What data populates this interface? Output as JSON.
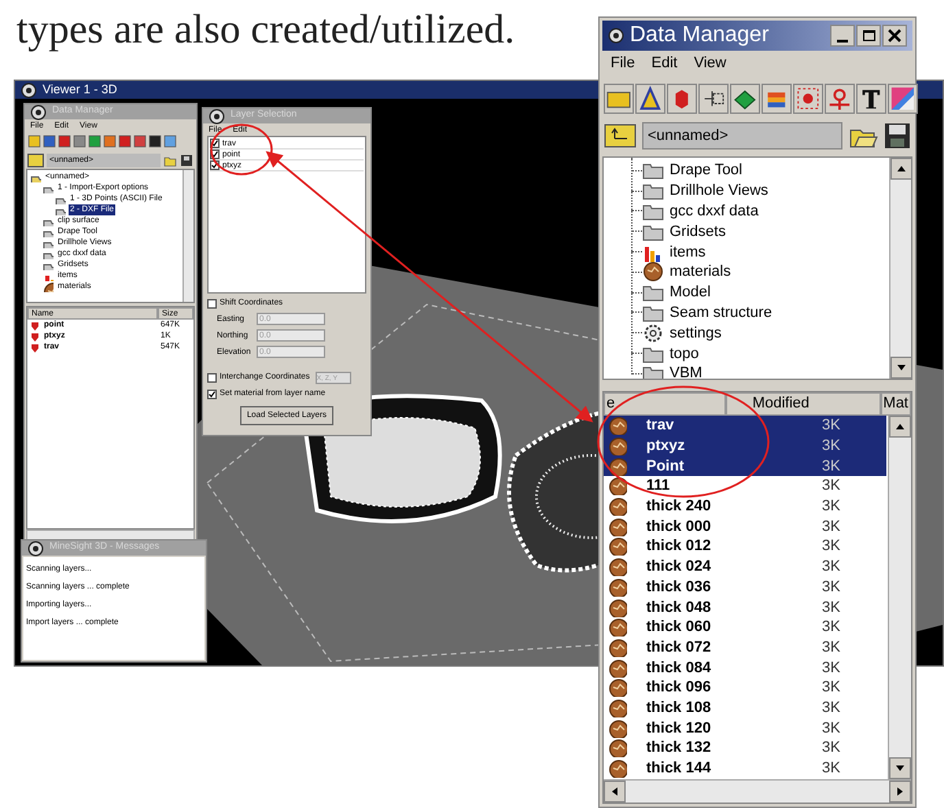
{
  "caption": "types are also created/utilized.",
  "viewer": {
    "title": "Viewer 1 - 3D"
  },
  "small_data_manager": {
    "title": "Data Manager",
    "menu": [
      "File",
      "Edit",
      "View"
    ],
    "path": "<unnamed>",
    "tree": [
      {
        "label": "<unnamed>",
        "kind": "root",
        "selected": false,
        "children": [
          {
            "label": "1 - Import-Export options",
            "kind": "folder",
            "selected": false,
            "children": [
              {
                "label": "1 - 3D Points (ASCII) File",
                "kind": "folder",
                "selected": false
              },
              {
                "label": "2 - DXF File",
                "kind": "folder",
                "selected": true
              }
            ]
          },
          {
            "label": "clip surface",
            "kind": "folder",
            "selected": false
          },
          {
            "label": "Drape Tool",
            "kind": "folder",
            "selected": false
          },
          {
            "label": "Drillhole Views",
            "kind": "folder",
            "selected": false
          },
          {
            "label": "gcc dxxf data",
            "kind": "folder",
            "selected": false
          },
          {
            "label": "Gridsets",
            "kind": "folder",
            "selected": false
          },
          {
            "label": "items",
            "kind": "chart",
            "selected": false
          },
          {
            "label": "materials",
            "kind": "material",
            "selected": false
          }
        ]
      }
    ],
    "columns": [
      "Name",
      "Size"
    ],
    "rows": [
      {
        "name": "point",
        "size": "647K"
      },
      {
        "name": "ptxyz",
        "size": "1K"
      },
      {
        "name": "trav",
        "size": "547K"
      }
    ]
  },
  "layer_selection": {
    "title": "Layer Selection",
    "menu": [
      "File",
      "Edit"
    ],
    "layers": [
      {
        "label": "trav",
        "checked": true
      },
      {
        "label": "point",
        "checked": true
      },
      {
        "label": "ptxyz",
        "checked": true
      }
    ],
    "shift_coordinates": {
      "label": "Shift Coordinates",
      "checked": false
    },
    "fields": [
      {
        "label": "Easting",
        "value": "0.0"
      },
      {
        "label": "Northing",
        "value": "0.0"
      },
      {
        "label": "Elevation",
        "value": "0.0"
      }
    ],
    "interchange": {
      "label": "Interchange Coordinates",
      "checked": false,
      "value": "X, Z, Y"
    },
    "set_material": {
      "label": "Set material from layer name",
      "checked": true
    },
    "button": "Load Selected Layers"
  },
  "messages": {
    "title": "MineSight 3D - Messages",
    "lines": [
      "Scanning layers...",
      "Scanning layers ... complete",
      "Importing layers...",
      "Import layers ... complete"
    ]
  },
  "data_manager": {
    "title": "Data Manager",
    "menu": [
      "File",
      "Edit",
      "View"
    ],
    "path": "<unnamed>",
    "tree": [
      {
        "label": "Drape Tool",
        "kind": "folder"
      },
      {
        "label": "Drillhole Views",
        "kind": "folder"
      },
      {
        "label": "gcc dxxf data",
        "kind": "folder"
      },
      {
        "label": "Gridsets",
        "kind": "folder"
      },
      {
        "label": "items",
        "kind": "chart"
      },
      {
        "label": "materials",
        "kind": "material"
      },
      {
        "label": "Model",
        "kind": "folder"
      },
      {
        "label": "Seam structure",
        "kind": "folder"
      },
      {
        "label": "settings",
        "kind": "settings"
      },
      {
        "label": "topo",
        "kind": "folder"
      },
      {
        "label": "VBM",
        "kind": "folder"
      }
    ],
    "columns": [
      "e",
      "Modified",
      "Mat"
    ],
    "rows": [
      {
        "name": "trav",
        "size": "3K",
        "selected": true
      },
      {
        "name": "ptxyz",
        "size": "3K",
        "selected": true
      },
      {
        "name": "Point",
        "size": "3K",
        "selected": true
      },
      {
        "name": "111",
        "size": "3K",
        "selected": false
      },
      {
        "name": "thick 240",
        "size": "3K",
        "selected": false
      },
      {
        "name": "thick 000",
        "size": "3K",
        "selected": false
      },
      {
        "name": "thick 012",
        "size": "3K",
        "selected": false
      },
      {
        "name": "thick 024",
        "size": "3K",
        "selected": false
      },
      {
        "name": "thick 036",
        "size": "3K",
        "selected": false
      },
      {
        "name": "thick 048",
        "size": "3K",
        "selected": false
      },
      {
        "name": "thick 060",
        "size": "3K",
        "selected": false
      },
      {
        "name": "thick 072",
        "size": "3K",
        "selected": false
      },
      {
        "name": "thick 084",
        "size": "3K",
        "selected": false
      },
      {
        "name": "thick 096",
        "size": "3K",
        "selected": false
      },
      {
        "name": "thick 108",
        "size": "3K",
        "selected": false
      },
      {
        "name": "thick 120",
        "size": "3K",
        "selected": false
      },
      {
        "name": "thick 132",
        "size": "3K",
        "selected": false
      },
      {
        "name": "thick 144",
        "size": "3K",
        "selected": false
      }
    ]
  }
}
